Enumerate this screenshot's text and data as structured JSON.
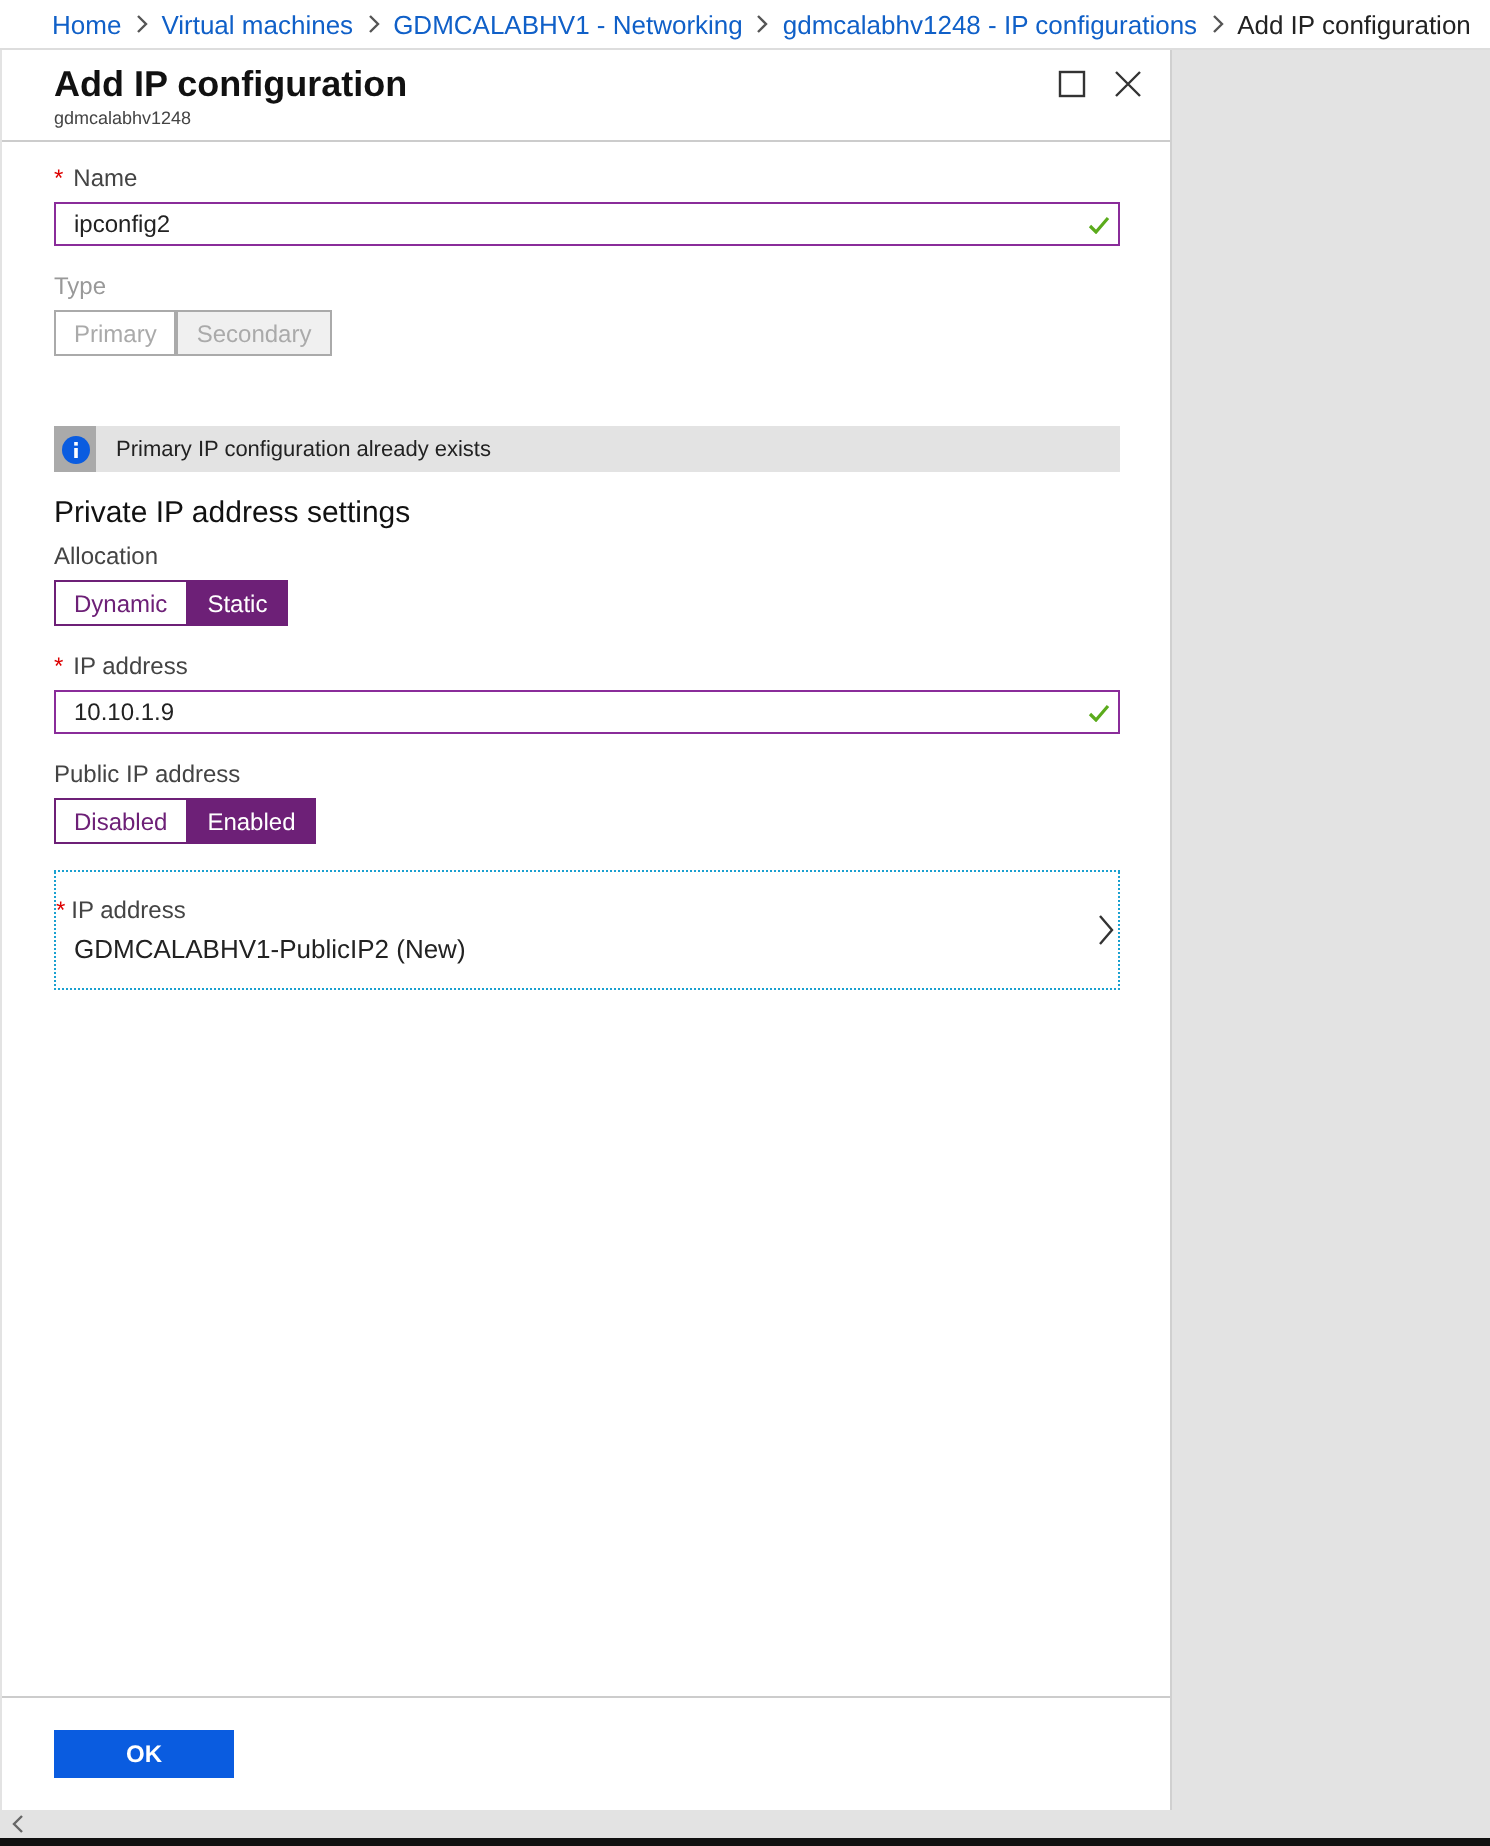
{
  "breadcrumb": [
    {
      "label": "Home",
      "current": false
    },
    {
      "label": "Virtual machines",
      "current": false
    },
    {
      "label": "GDMCALABHV1 - Networking",
      "current": false
    },
    {
      "label": "gdmcalabhv1248 - IP configurations",
      "current": false
    },
    {
      "label": "Add IP configuration",
      "current": true
    }
  ],
  "blade": {
    "title": "Add IP configuration",
    "subtitle": "gdmcalabhv1248"
  },
  "sections": [
    {
      "kind": "field",
      "label": "Name",
      "required_mark": "*",
      "value": "ipconfig2",
      "valid": true
    },
    {
      "kind": "toggle",
      "label": "Type",
      "disabled": true,
      "options": [
        {
          "label": "Primary",
          "selected": false
        },
        {
          "label": "Secondary",
          "selected": true
        }
      ]
    },
    {
      "kind": "info",
      "text": "Primary IP configuration already exists"
    },
    {
      "kind": "heading",
      "text": "Private IP address settings"
    },
    {
      "kind": "toggle",
      "label": "Allocation",
      "disabled": false,
      "options": [
        {
          "label": "Dynamic",
          "selected": false
        },
        {
          "label": "Static",
          "selected": true
        }
      ]
    },
    {
      "kind": "field",
      "label": "IP address",
      "required_mark": "*",
      "value": "10.10.1.9",
      "valid": true
    },
    {
      "kind": "toggle",
      "label": "Public IP address",
      "disabled": false,
      "options": [
        {
          "label": "Disabled",
          "selected": false
        },
        {
          "label": "Enabled",
          "selected": true
        }
      ]
    },
    {
      "kind": "picker",
      "label": "IP address",
      "required_mark": "*",
      "value": "GDMCALABHV1-PublicIP2 (New)"
    }
  ],
  "footer": {
    "button": "OK"
  }
}
